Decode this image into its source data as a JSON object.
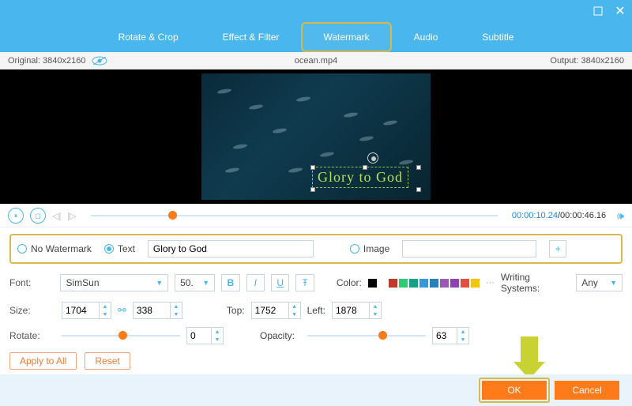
{
  "window": {
    "minimize": "—",
    "close": "✕"
  },
  "tabs": [
    {
      "label": "Rotate & Crop"
    },
    {
      "label": "Effect & Filter"
    },
    {
      "label": "Watermark"
    },
    {
      "label": "Audio"
    },
    {
      "label": "Subtitle"
    }
  ],
  "activeTab": 2,
  "infobar": {
    "original_label": "Original: 3840x2160",
    "filename": "ocean.mp4",
    "output_label": "Output: 3840x2160"
  },
  "preview": {
    "watermark_preview": "Glory to God"
  },
  "playback": {
    "current": "00:00:10.24",
    "sep": "/",
    "total": "00:00:46.16"
  },
  "watermark": {
    "none_label": "No Watermark",
    "text_label": "Text",
    "text_value": "Glory to God",
    "image_label": "Image",
    "image_value": "",
    "selected": "text"
  },
  "font": {
    "label": "Font:",
    "family": "SimSun",
    "size": "50.",
    "color_label": "Color:",
    "writing_label": "Writing Systems:",
    "writing_value": "Any"
  },
  "size": {
    "label": "Size:",
    "w": "1704",
    "h": "338"
  },
  "pos": {
    "top_label": "Top:",
    "top": "1752",
    "left_label": "Left:",
    "left": "1878"
  },
  "rotate": {
    "label": "Rotate:",
    "value": "0"
  },
  "opacity": {
    "label": "Opacity:",
    "value": "63"
  },
  "buttons": {
    "apply": "Apply to All",
    "reset": "Reset",
    "ok": "OK",
    "cancel": "Cancel"
  },
  "colors": [
    "#000000",
    "#ffffff",
    "#c0392b",
    "#2ecc71",
    "#16a085",
    "#3498db",
    "#2980b9",
    "#9b59b6",
    "#8e44ad",
    "#e74c3c",
    "#f1c40f"
  ]
}
